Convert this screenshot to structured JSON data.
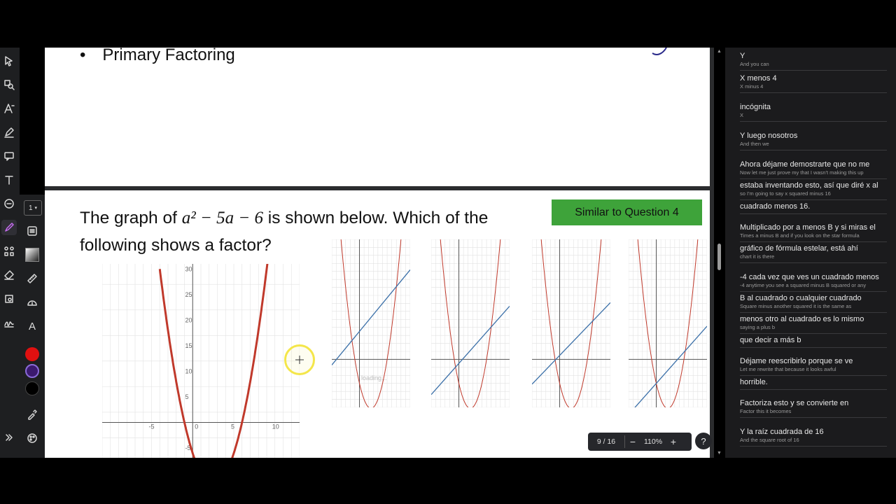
{
  "page": {
    "bullet_text": "Primary Factoring",
    "question_prefix": "The graph of ",
    "question_math": "a² − 5a − 6",
    "question_suffix": " is shown below. Which of the following shows a factor?",
    "similar_button": "Similar to Question 4",
    "loading_text": "loading..."
  },
  "toolbar": {
    "tools": [
      "select-icon",
      "zoom-region-icon",
      "text-style-icon",
      "highlighter-icon",
      "comment-icon",
      "text-icon",
      "shape-icon",
      "draw-icon",
      "layout-icon",
      "eraser-icon",
      "measure-icon",
      "protractor-icon",
      "crop-icon",
      "signature-icon",
      "expand-icon"
    ],
    "stroke_width": "1",
    "colors": [
      "#e01010",
      "#3b1a6e",
      "#000000"
    ]
  },
  "pager": {
    "page_indicator": "9 / 16",
    "zoom_out": "−",
    "zoom_level": "110%",
    "zoom_in": "+",
    "help": "?"
  },
  "captions": [
    {
      "es": "Y",
      "en": "And you can"
    },
    {
      "es": "X menos 4",
      "en": "X minus 4"
    },
    {
      "es": "incógnita",
      "en": "X"
    },
    {
      "es": "Y luego nosotros",
      "en": "And then we"
    },
    {
      "es": "Ahora déjame demostrarte que no me",
      "en": "Now let me just prove my that I wasn't making this up"
    },
    {
      "es": "estaba inventando esto, así que diré x al",
      "en": "so I'm going to say x squared minus 16"
    },
    {
      "es": "cuadrado menos 16.",
      "en": ""
    },
    {
      "es": "Multiplicado por a menos B y si miras el",
      "en": "Times a minus B and if you look on the star formula"
    },
    {
      "es": "gráfico de fórmula estelar, está ahí",
      "en": "chart it is there"
    },
    {
      "es": "-4 cada vez que ves un cuadrado menos",
      "en": "-4 anytime you see a squared minus B squared or any"
    },
    {
      "es": "B al cuadrado o cualquier cuadrado",
      "en": "Square minus another squared it is the same as"
    },
    {
      "es": "menos otro al cuadrado es lo mismo",
      "en": "saying a plus b"
    },
    {
      "es": "que decir a más b",
      "en": ""
    },
    {
      "es": "Déjame reescribirlo porque se ve",
      "en": "Let me rewrite that because it looks awful"
    },
    {
      "es": "horrible.",
      "en": ""
    },
    {
      "es": "Factoriza esto y se convierte en",
      "en": "Factor this it becomes"
    },
    {
      "es": "Y la raíz cuadrada de 16",
      "en": "And the square root of 16"
    }
  ],
  "chart_data": [
    {
      "type": "line",
      "series": [
        {
          "values_fn": "y = a^2 - 5a - 6"
        }
      ],
      "xlim": [
        -6,
        11
      ],
      "ylim": [
        -8,
        30
      ],
      "x_ticks": [
        "-5",
        "0",
        "5",
        "10"
      ],
      "y_ticks": [
        "-5",
        "5",
        "10",
        "15",
        "20",
        "25",
        "30"
      ]
    },
    {
      "type": "line",
      "xlim": [
        -6,
        11
      ],
      "ylim": [
        -12,
        30
      ],
      "series": [
        {
          "name": "",
          "values_fn": "parabola"
        },
        {
          "name": "",
          "values_fn": "line"
        }
      ]
    },
    {
      "type": "line",
      "xlim": [
        -6,
        11
      ],
      "ylim": [
        -12,
        30
      ],
      "series": [
        {
          "name": "",
          "values_fn": "parabola"
        },
        {
          "name": "",
          "values_fn": "line"
        }
      ]
    },
    {
      "type": "line",
      "xlim": [
        -6,
        11
      ],
      "ylim": [
        -12,
        30
      ],
      "series": [
        {
          "name": "",
          "values_fn": "parabola"
        },
        {
          "name": "",
          "values_fn": "line"
        }
      ]
    },
    {
      "type": "line",
      "xlim": [
        -6,
        11
      ],
      "ylim": [
        -12,
        30
      ],
      "series": [
        {
          "name": "",
          "values_fn": "parabola"
        },
        {
          "name": "",
          "values_fn": "line"
        }
      ]
    }
  ]
}
